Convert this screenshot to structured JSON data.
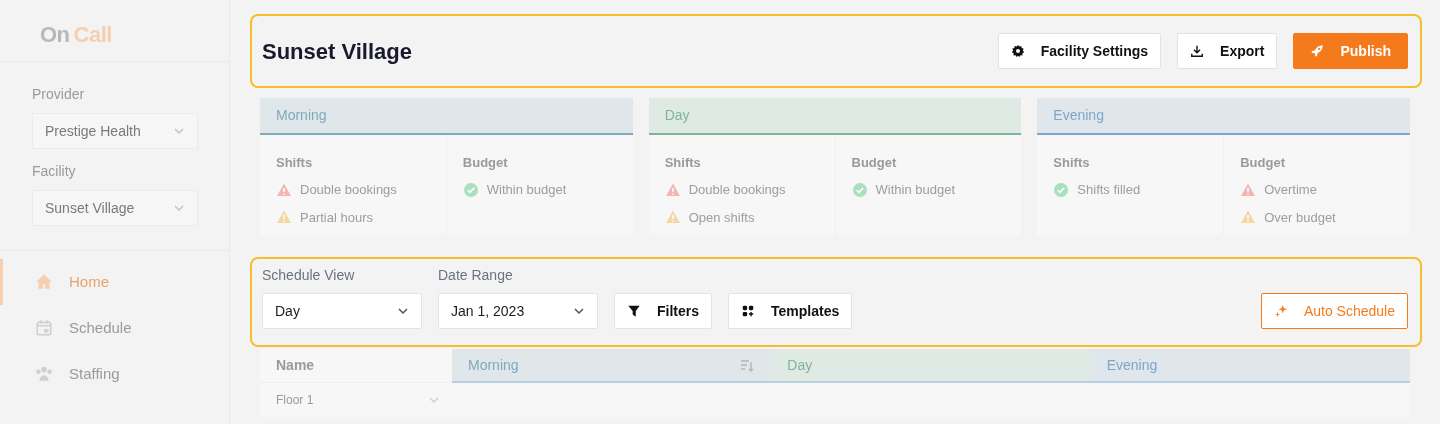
{
  "sidebar": {
    "logo": {
      "part_1": "On",
      "part_2": "Call"
    },
    "selectors": [
      {
        "label": "Provider",
        "value": "Prestige Health"
      },
      {
        "label": "Facility",
        "value": "Sunset Village"
      }
    ],
    "nav": [
      {
        "label": "Home",
        "selected": true,
        "kind": "home"
      },
      {
        "label": "Schedule",
        "selected": false,
        "kind": "calendar"
      },
      {
        "label": "Staffing",
        "selected": false,
        "kind": "people"
      }
    ]
  },
  "header": {
    "title": "Sunset Village",
    "highlighted": true,
    "buttons": [
      {
        "label": "Facility Settings",
        "kind": "settings"
      },
      {
        "label": "Export",
        "kind": "export"
      },
      {
        "label": "Publish",
        "kind": "publish"
      }
    ]
  },
  "shift_cards": [
    {
      "title": "Morning",
      "color": "#7fa9bd",
      "sections": [
        {
          "label": "Shifts",
          "items": [
            {
              "text": "Double bookings",
              "kind": "error"
            },
            {
              "text": "Partial hours",
              "kind": "warning"
            }
          ]
        },
        {
          "label": "Budget",
          "items": [
            {
              "text": "Within budget",
              "kind": "ok"
            }
          ]
        }
      ]
    },
    {
      "title": "Day",
      "color": "#7fb59b",
      "sections": [
        {
          "label": "Shifts",
          "items": [
            {
              "text": "Double bookings",
              "kind": "error"
            },
            {
              "text": "Open shifts",
              "kind": "warning"
            }
          ]
        },
        {
          "label": "Budget",
          "items": [
            {
              "text": "Within budget",
              "kind": "ok"
            }
          ]
        }
      ]
    },
    {
      "title": "Evening",
      "color": "#7fa6c6",
      "sections": [
        {
          "label": "Shifts",
          "items": [
            {
              "text": "Shifts filled",
              "kind": "ok"
            }
          ]
        },
        {
          "label": "Budget",
          "items": [
            {
              "text": "Overtime",
              "kind": "error"
            },
            {
              "text": "Over budget",
              "kind": "warning"
            }
          ]
        }
      ]
    }
  ],
  "toolbar": {
    "highlighted": true,
    "selects": [
      {
        "label": "Schedule View",
        "value": "Day"
      },
      {
        "label": "Date Range",
        "value": "Jan 1, 2023"
      }
    ],
    "buttons": [
      {
        "label": "Filters",
        "kind": "filter"
      },
      {
        "label": "Templates",
        "kind": "templates"
      }
    ],
    "auto_schedule": {
      "label": "Auto Schedule"
    }
  },
  "table": {
    "columns": [
      {
        "label": "Name",
        "kind": "name"
      },
      {
        "label": "Morning",
        "kind": "shift",
        "color": "#7fa9bd",
        "sortable": true
      },
      {
        "label": "Day",
        "kind": "shift",
        "color": "#7fb59b",
        "sortable": false
      },
      {
        "label": "Evening",
        "kind": "shift",
        "color": "#7fa6c6",
        "sortable": false
      }
    ],
    "rows": [
      {
        "name": "Floor 1",
        "expanded": false
      }
    ]
  }
}
